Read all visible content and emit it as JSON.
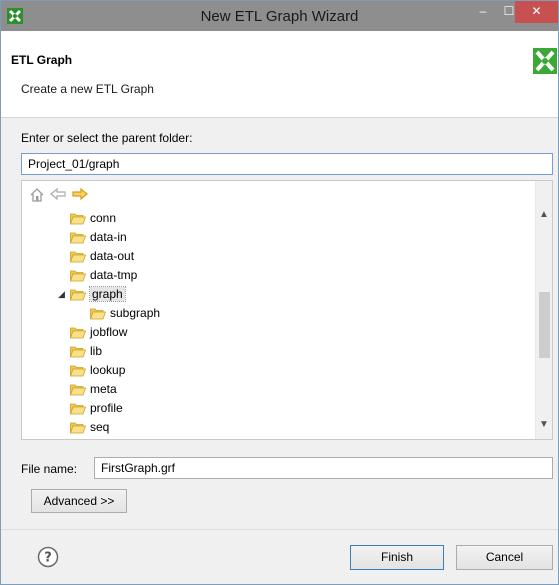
{
  "window": {
    "title": "New ETL Graph Wizard",
    "minimize_symbol": "–",
    "maximize_symbol": "☐",
    "close_symbol": "✕"
  },
  "header": {
    "title": "ETL Graph",
    "description": "Create a new ETL Graph"
  },
  "folder": {
    "label": "Enter or select the parent folder:",
    "value": "Project_01/graph"
  },
  "tree": {
    "items": [
      {
        "label": "conn",
        "level": 1
      },
      {
        "label": "data-in",
        "level": 1
      },
      {
        "label": "data-out",
        "level": 1
      },
      {
        "label": "data-tmp",
        "level": 1
      },
      {
        "label": "graph",
        "level": 1,
        "expanded": true,
        "selected": true
      },
      {
        "label": "subgraph",
        "level": 2
      },
      {
        "label": "jobflow",
        "level": 1
      },
      {
        "label": "lib",
        "level": 1
      },
      {
        "label": "lookup",
        "level": 1
      },
      {
        "label": "meta",
        "level": 1
      },
      {
        "label": "profile",
        "level": 1
      },
      {
        "label": "seq",
        "level": 1
      }
    ]
  },
  "file": {
    "label": "File name:",
    "value": "FirstGraph.grf"
  },
  "buttons": {
    "advanced": "Advanced >>",
    "finish": "Finish",
    "cancel": "Cancel"
  },
  "icons": {
    "home": "home-icon",
    "back": "back-arrow-icon",
    "forward": "forward-arrow-icon",
    "help": "help-icon",
    "folder": "folder-open-icon"
  },
  "colors": {
    "titlebar": "#8e8e8e",
    "close": "#c75050",
    "logo_green": "#3aa935",
    "folder_yellow": "#f2c94c",
    "nav_arrow": "#e5a823"
  }
}
